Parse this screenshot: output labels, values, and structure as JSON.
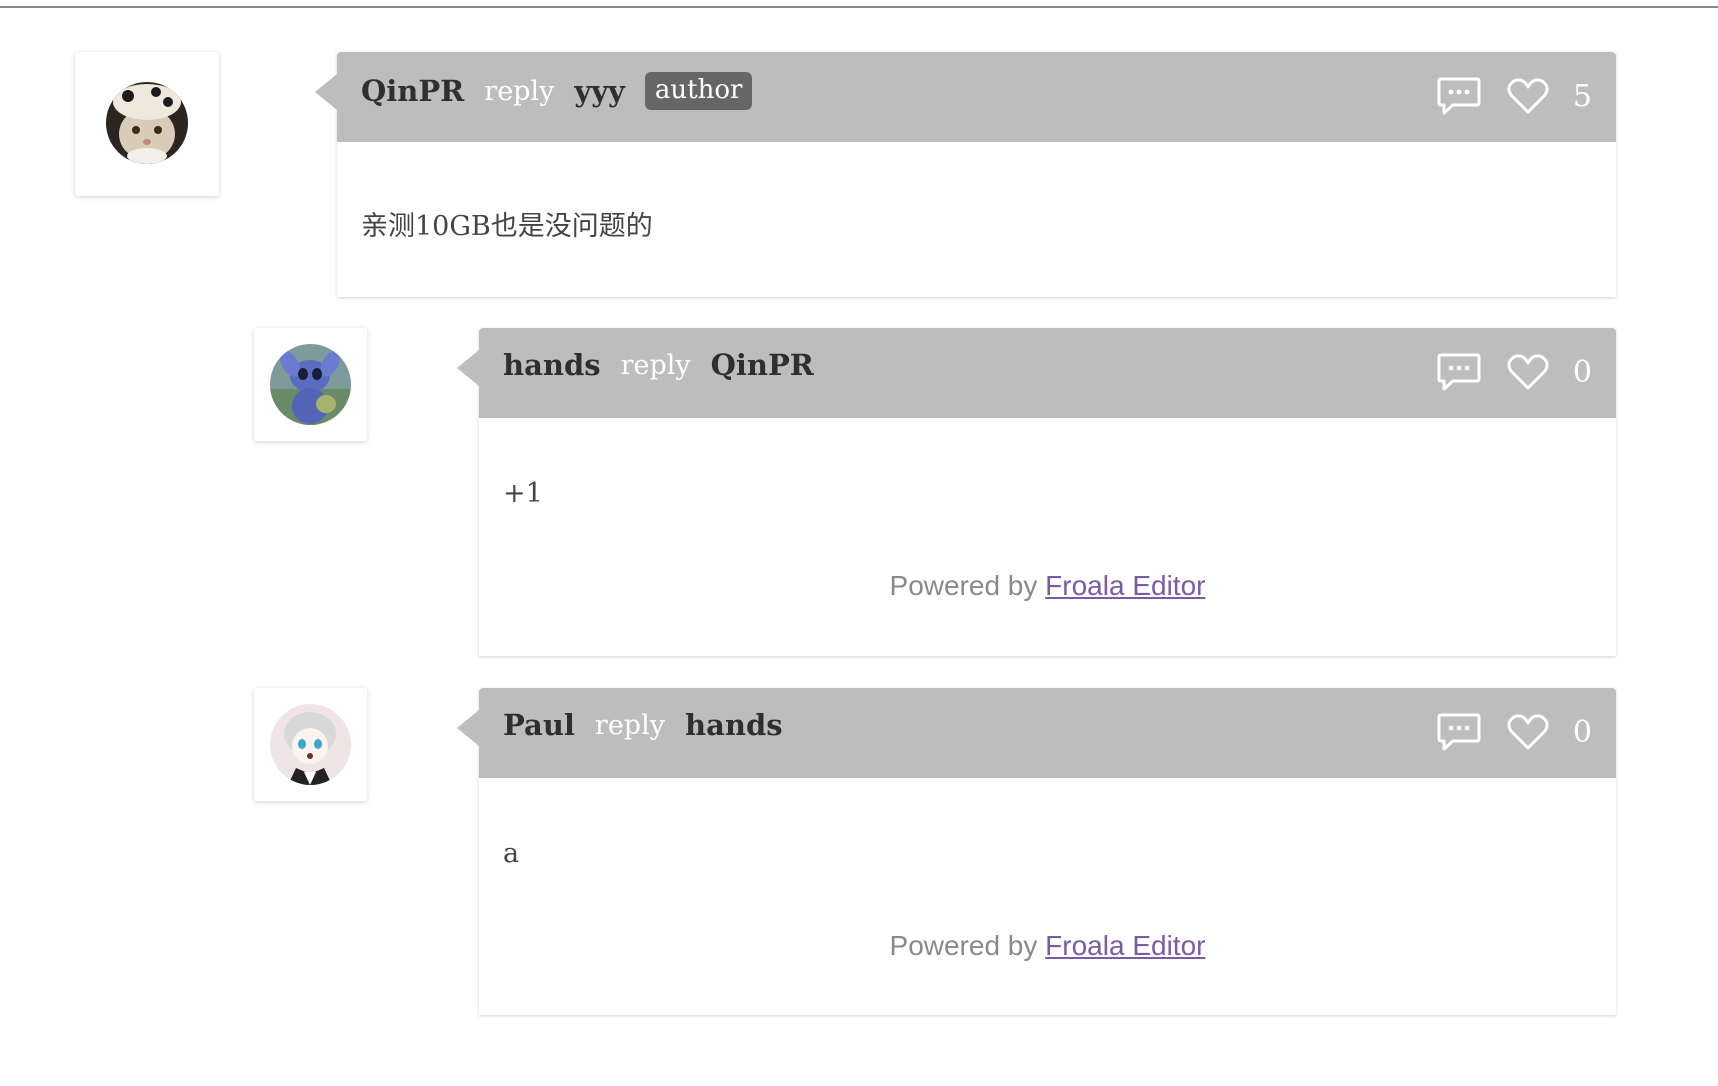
{
  "comments": [
    {
      "author": "QinPR",
      "reply_label": "reply",
      "reply_to": "yyy",
      "badge": "author",
      "likes": "5",
      "text": "亲测10GB也是没问题的",
      "avatar": "cat-avatar"
    },
    {
      "author": "hands",
      "reply_label": "reply",
      "reply_to": "QinPR",
      "likes": "0",
      "text": "+1",
      "powered_prefix": "Powered by",
      "powered_link": "Froala Editor",
      "avatar": "stitch-avatar"
    },
    {
      "author": "Paul",
      "reply_label": "reply",
      "reply_to": "hands",
      "likes": "0",
      "text": "a",
      "powered_prefix": "Powered by",
      "powered_link": "Froala Editor",
      "avatar": "anime-avatar"
    }
  ]
}
